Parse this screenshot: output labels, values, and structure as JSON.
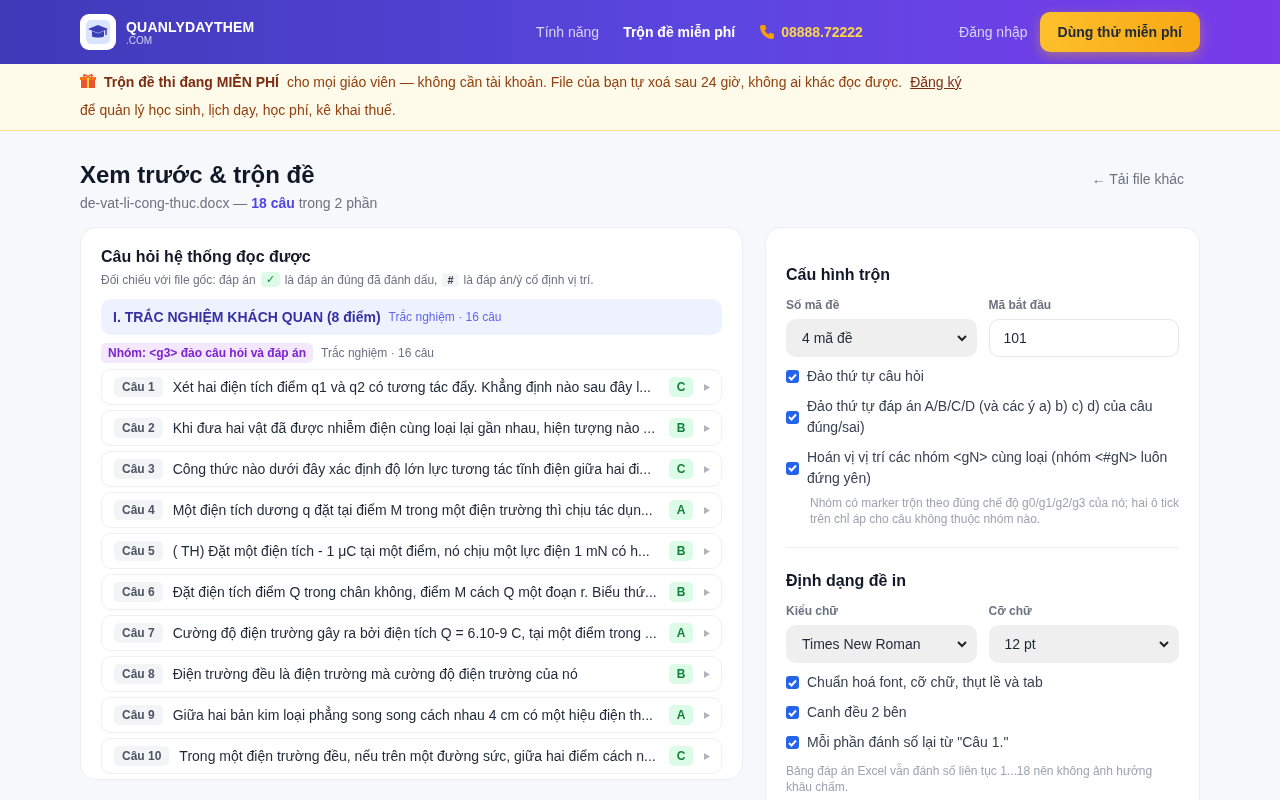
{
  "header": {
    "logo": {
      "name": "QUANLYDAYTHEM",
      "suffix": ".COM"
    },
    "nav": [
      {
        "label": "Tính năng",
        "selected": false
      },
      {
        "label": "Trộn đề miễn phí",
        "selected": true
      }
    ],
    "phone": "08888.72222",
    "login": "Đăng nhập",
    "cta": "Dùng thử miễn phí"
  },
  "banner": {
    "text": "**Trộn đề thi đang MIỄN PHÍ** cho mọi giáo viên — không cần tài khoản. File của bạn tự xoá sau 24 giờ, không ai khác đọc được.",
    "link": "Đăng ký",
    "text_after": "để quản lý học sinh, lịch dạy, học phí, kê khai thuế."
  },
  "page": {
    "title": "Xem trước & trộn đề",
    "subtitle": "de-vat-li-cong-thuc.docx — **18 câu** trong 2 phần",
    "back_link": "← Tải file khác"
  },
  "preview": {
    "title": "Câu hỏi hệ thống đọc được",
    "legend": [
      {
        "kind": "text",
        "text": "Đối chiếu với file gốc: đáp án"
      },
      {
        "kind": "chip_correct",
        "text": "✓"
      },
      {
        "kind": "text",
        "text": "là đáp án đúng đã đánh dấu,"
      },
      {
        "kind": "chip_fixed",
        "text": "#"
      },
      {
        "kind": "text",
        "text": "là đáp án/ý cố định vị trí."
      }
    ],
    "section": {
      "title": "I. TRẮC NGHIỆM KHÁCH QUAN (8 điểm)",
      "meta": "Trắc nghiệm · 16 câu"
    },
    "group": {
      "tag": "Nhóm: <g3> đảo câu hỏi và đáp án",
      "meta": "Trắc nghiệm · 16 câu"
    },
    "questions": [
      {
        "number": "Câu 1",
        "text": "Xét hai điện tích điểm q1 và q2 có tương tác đẩy. Khẳng định nào sau đây l...",
        "answer": "C"
      },
      {
        "number": "Câu 2",
        "text": "Khi đưa hai vật đã được nhiễm điện cùng loại lại gần nhau, hiện tượng nào ...",
        "answer": "B"
      },
      {
        "number": "Câu 3",
        "text": "Công thức nào dưới đây xác định độ lớn lực tương tác tĩnh điện giữa hai đi...",
        "answer": "C"
      },
      {
        "number": "Câu 4",
        "text": "Một điện tích dương q đặt tại điểm M trong một điện trường thì chịu tác dụn...",
        "answer": "A"
      },
      {
        "number": "Câu 5",
        "text": "( TH) Đặt một điện tích - 1 μC tại một điểm, nó chịu một lực điện 1 mN có h...",
        "answer": "B"
      },
      {
        "number": "Câu 6",
        "text": "Đặt điện tích điểm Q trong chân không, điểm M cách Q một đoạn r. Biểu thứ...",
        "answer": "B"
      },
      {
        "number": "Câu 7",
        "text": "Cường độ điện trường gây ra bởi điện tích Q = 6.10-9 C, tại một điểm trong ...",
        "answer": "A"
      },
      {
        "number": "Câu 8",
        "text": "Điện trường đều là điện trường mà cường độ điện trường của nó",
        "answer": "B"
      },
      {
        "number": "Câu 9",
        "text": "Giữa hai bản kim loại phẳng song song cách nhau 4 cm có một hiệu điện th...",
        "answer": "A"
      },
      {
        "number": "Câu 10",
        "text": "Trong một điện trường đều, nếu trên một đường sức, giữa hai điểm cách n...",
        "answer": "C"
      }
    ]
  },
  "config": {
    "sections": [
      {
        "title": "Cấu hình trộn",
        "fields": [
          {
            "label": "Số mã đề",
            "kind": "select",
            "value": "4 mã đề"
          },
          {
            "label": "Mã bắt đầu",
            "kind": "input",
            "value": "101"
          }
        ],
        "options": [
          {
            "label": "Đảo thứ tự câu hỏi",
            "checked": true
          },
          {
            "label": "Đảo thứ tự đáp án A/B/C/D (và các ý a) b) c) d) của câu đúng/sai)",
            "checked": true
          },
          {
            "label": "Hoán vị vị trí các nhóm <gN> cùng loại (nhóm <#gN> luôn đứng yên)",
            "checked": true
          }
        ],
        "note": "Nhóm có marker trộn theo đúng chế độ g0/g1/g2/g3 của nó; hai ô tick trên chỉ áp cho câu không thuộc nhóm nào."
      },
      {
        "title": "Định dạng đề in",
        "fields": [
          {
            "label": "Kiểu chữ",
            "kind": "select",
            "value": "Times New Roman"
          },
          {
            "label": "Cỡ chữ",
            "kind": "select",
            "value": "12 pt"
          }
        ],
        "options": [
          {
            "label": "Chuẩn hoá font, cỡ chữ, thụt lề và tab",
            "checked": true
          },
          {
            "label": "Canh đều 2 bên",
            "checked": true
          },
          {
            "label": "Mỗi phần đánh số lại từ \"Câu 1.\"",
            "checked": true
          }
        ],
        "note": "Bảng đáp án Excel vẫn đánh số liên tục 1...18 nên không ảnh hưởng khâu chấm."
      }
    ]
  }
}
